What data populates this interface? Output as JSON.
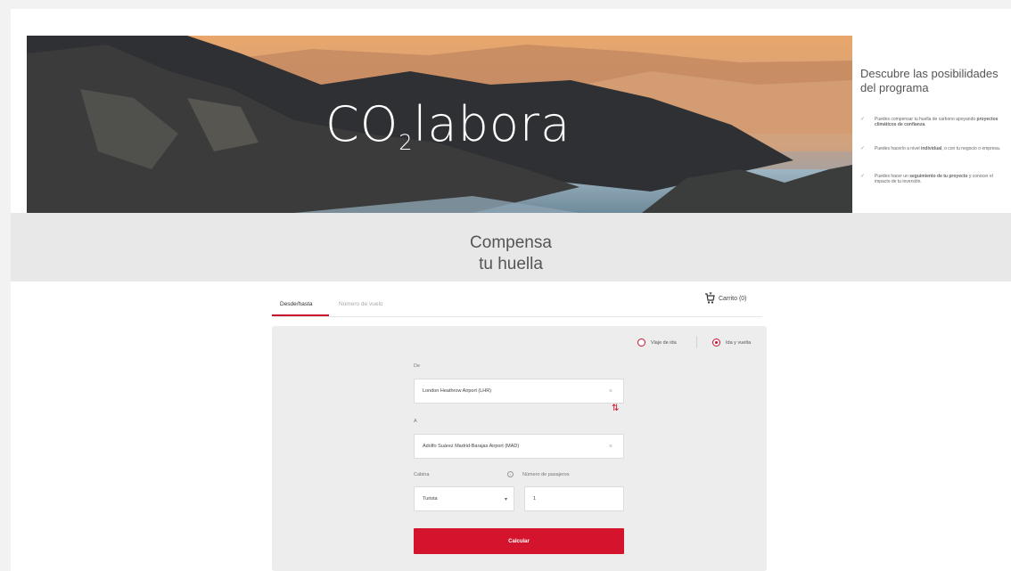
{
  "hero": {
    "logo_pre": "CO",
    "logo_sub": "2",
    "logo_post": "labora"
  },
  "aside": {
    "title": "Descubre las posibilidades del programa",
    "bullets": [
      {
        "pre": "Puedes compensar tu huella de carbono apoyando ",
        "bold": "proyectos climáticos de confianza",
        "post": "."
      },
      {
        "pre": "Puedes hacerlo a nivel ",
        "bold": "individual",
        "post": ", o con tu negocio o empresa."
      },
      {
        "pre": "Puedes hacer un ",
        "bold": "seguimiento de tu proyecto",
        "post": " y conocer el impacto de tu inversión."
      }
    ]
  },
  "band": {
    "title_line1": "Compensa",
    "title_line2": "tu huella"
  },
  "tabs": [
    {
      "label": "Desde/hasta"
    },
    {
      "label": "Número de vuelo"
    }
  ],
  "cart": {
    "label": "Carrito (0)"
  },
  "form": {
    "trip_one_way": "Viaje de ida",
    "trip_round": "Ida y vuelta",
    "from_label": "De",
    "from_value": "London Heathrow Airport (LHR)",
    "to_label": "A",
    "to_value": "Adolfo Suárez Madrid-Barajas Airport (MAD)",
    "cabin_label": "Cabina",
    "passengers_label": "Número de pasajeros",
    "cabin_value": "Turista",
    "passengers_value": "1",
    "submit": "Calcular",
    "clear_glyph": "×"
  },
  "colors": {
    "accent": "#d4132d"
  }
}
